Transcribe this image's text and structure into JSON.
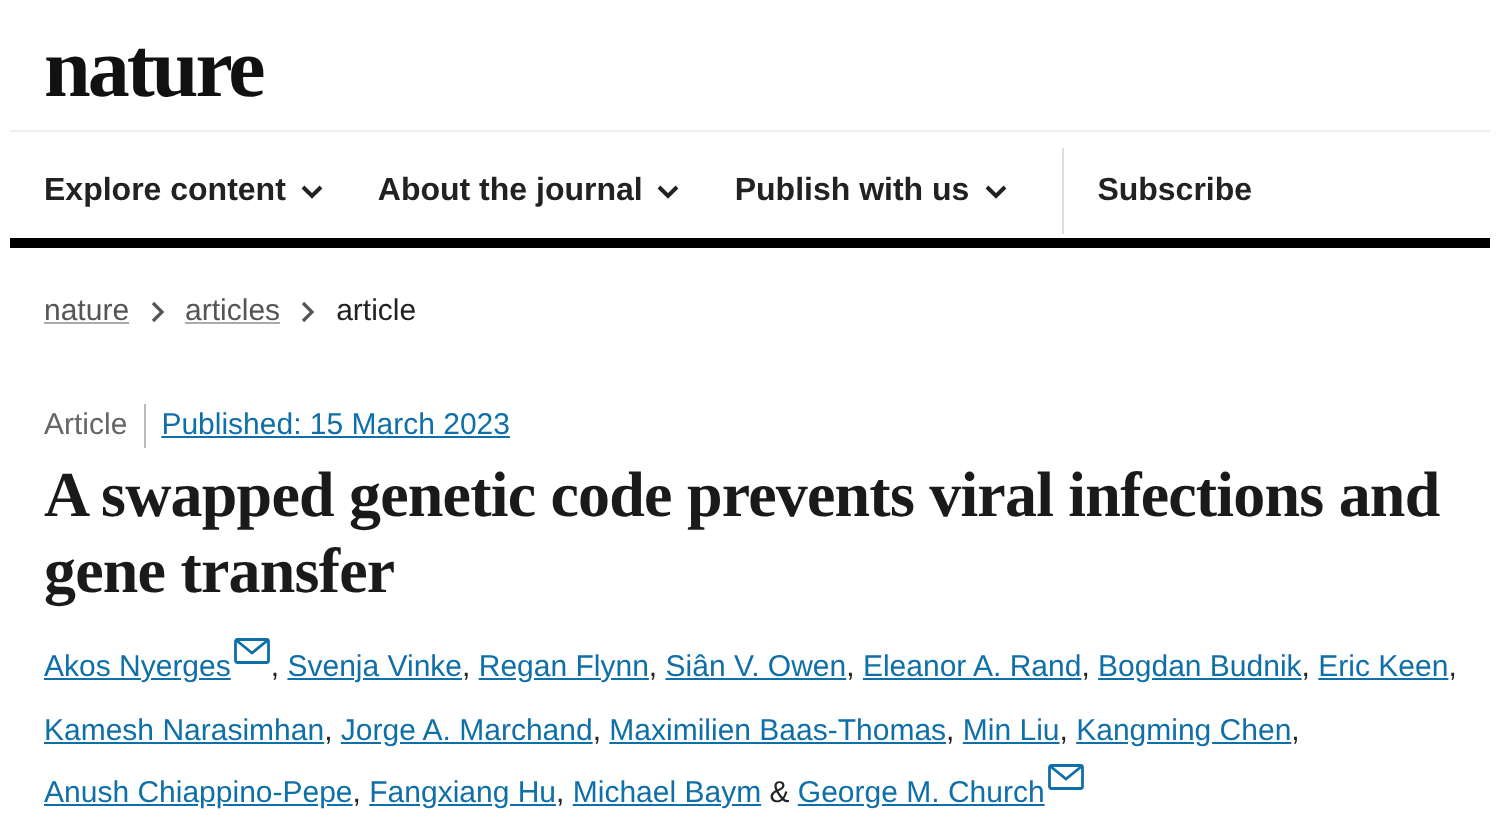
{
  "logo": "nature",
  "nav": [
    {
      "label": "Explore content",
      "dropdown": true
    },
    {
      "label": "About the journal",
      "dropdown": true
    },
    {
      "label": "Publish with us",
      "dropdown": true
    },
    {
      "label": "Subscribe",
      "dropdown": false
    }
  ],
  "breadcrumb": [
    {
      "label": "nature",
      "link": true
    },
    {
      "label": "articles",
      "link": true
    },
    {
      "label": "article",
      "link": false
    }
  ],
  "article_type": "Article",
  "published": "Published: 15 March 2023",
  "title": "A swapped genetic code prevents viral infections and gene transfer",
  "authors": [
    {
      "name": "Akos Nyerges",
      "email": true,
      "separator": ","
    },
    {
      "name": "Svenja Vinke",
      "email": false,
      "separator": ","
    },
    {
      "name": "Regan Flynn",
      "email": false,
      "separator": ","
    },
    {
      "name": "Siân V. Owen",
      "email": false,
      "separator": ","
    },
    {
      "name": "Eleanor A. Rand",
      "email": false,
      "separator": ","
    },
    {
      "name": "Bogdan Budnik",
      "email": false,
      "separator": ","
    },
    {
      "name": "Eric Keen",
      "email": false,
      "separator": ","
    },
    {
      "name": "Kamesh Narasimhan",
      "email": false,
      "separator": ","
    },
    {
      "name": "Jorge A. Marchand",
      "email": false,
      "separator": ","
    },
    {
      "name": "Maximilien Baas-Thomas",
      "email": false,
      "separator": ","
    },
    {
      "name": "Min Liu",
      "email": false,
      "separator": ","
    },
    {
      "name": "Kangming Chen",
      "email": false,
      "separator": ","
    },
    {
      "name": "Anush Chiappino-Pepe",
      "email": false,
      "separator": ","
    },
    {
      "name": "Fangxiang Hu",
      "email": false,
      "separator": ","
    },
    {
      "name": "Michael Baym",
      "email": false,
      "separator": "&"
    },
    {
      "name": "George M. Church",
      "email": true
    }
  ]
}
